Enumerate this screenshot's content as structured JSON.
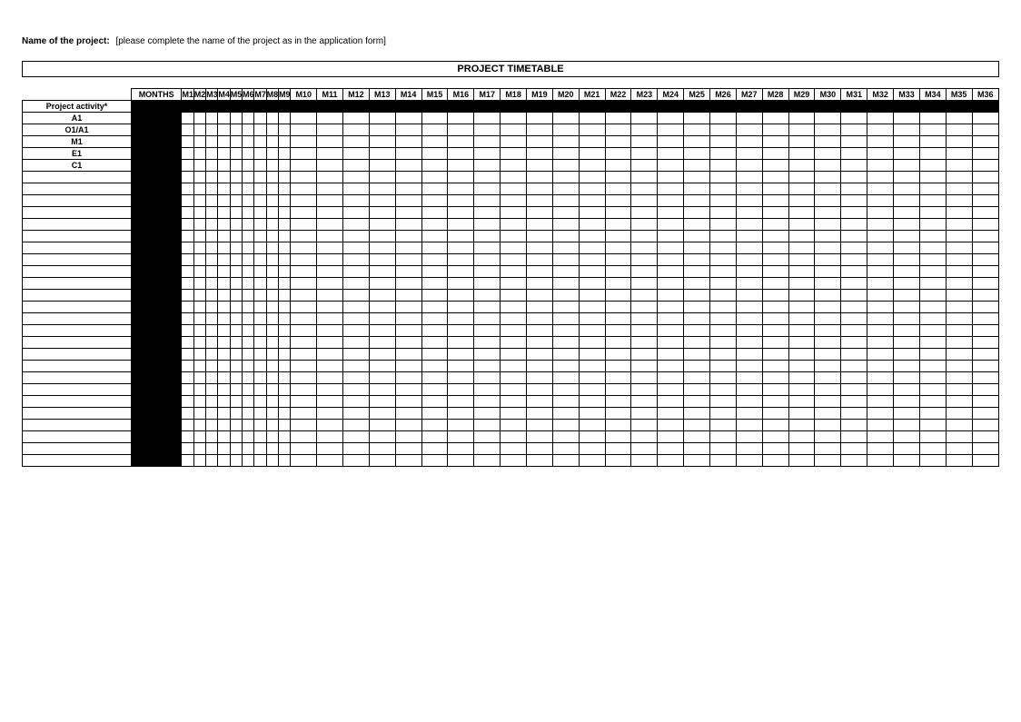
{
  "header": {
    "name_label": "Name of the project:",
    "name_value": "[please complete the name of the project as in the application form]",
    "title": "PROJECT TIMETABLE"
  },
  "table": {
    "activity_header": "Project activity*",
    "months_header": "MONTHS",
    "month_count": 36,
    "activities": [
      "A1",
      "O1/A1",
      "M1",
      "E1",
      "C1"
    ],
    "blank_rows": 25
  }
}
